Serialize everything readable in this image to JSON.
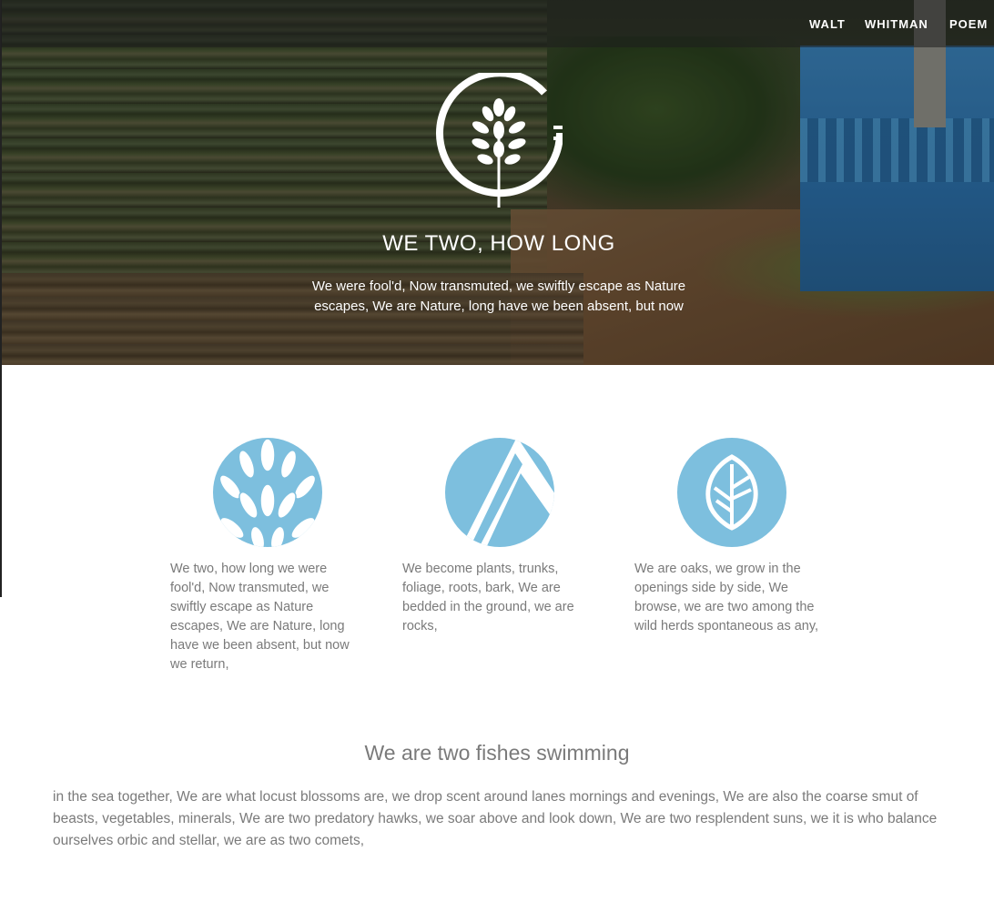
{
  "nav": {
    "items": [
      "WALT",
      "WHITMAN",
      "POEM"
    ]
  },
  "hero": {
    "title": "WE TWO, HOW LONG",
    "text": "We were fool'd, Now transmuted, we swiftly escape as Nature escapes, We are Nature, long have we been absent, but now"
  },
  "features": [
    {
      "icon": "leaves-icon",
      "text": "We two, how long we were fool'd, Now transmuted, we swiftly escape as Nature escapes, We are Nature, long have we been absent, but now we return,"
    },
    {
      "icon": "mountain-icon",
      "text": "We become plants, trunks, foliage, roots, bark, We are bedded in the ground, we are rocks,"
    },
    {
      "icon": "leaf-icon",
      "text": "We are oaks, we grow in the openings side by side, We browse, we are two among the wild herds spontaneous as any,"
    }
  ],
  "section": {
    "title": "We are two fishes swimming",
    "text": "in the sea together, We are what locust blossoms are, we drop scent around lanes mornings and evenings, We are also the coarse smut of beasts, vegetables, minerals, We are two predatory hawks, we soar above and look down, We are two resplendent suns, we it is who balance ourselves orbic and stellar, we are as two comets,"
  },
  "colors": {
    "accent": "#7dbfde",
    "text": "#7a7a7a"
  }
}
